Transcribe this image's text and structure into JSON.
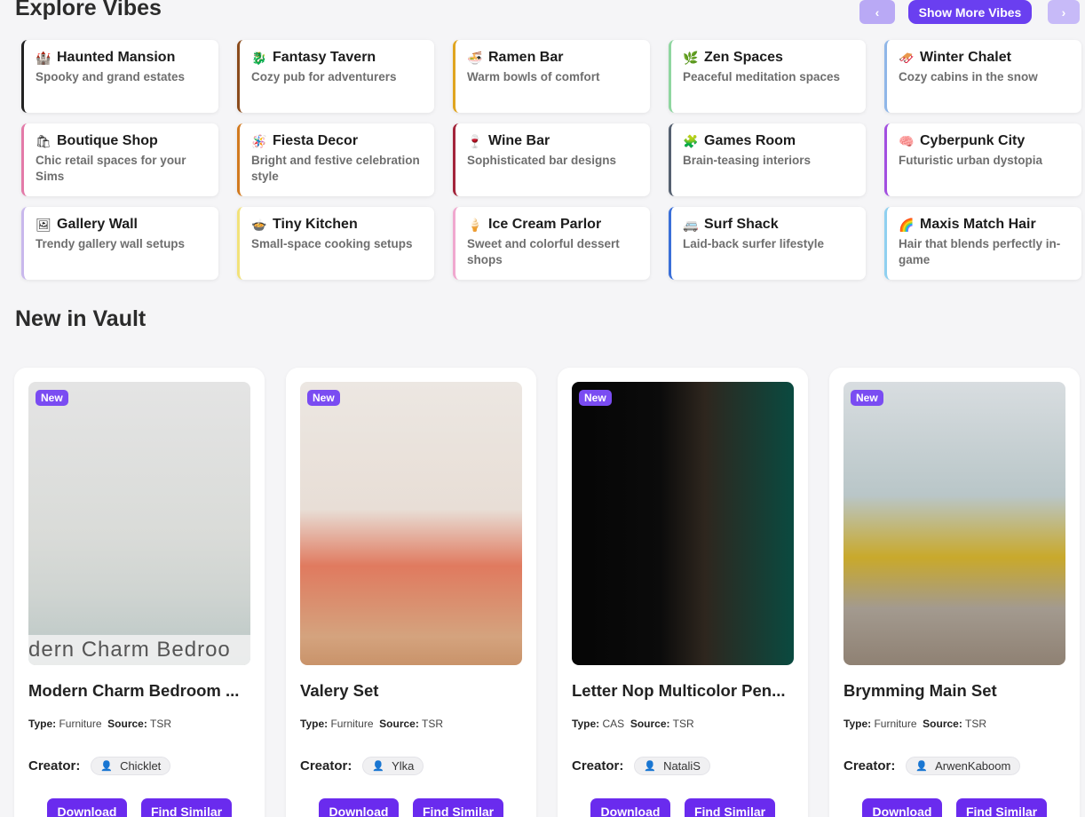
{
  "explore": {
    "title": "Explore Vibes",
    "prev_label": "‹",
    "more_label": "Show More Vibes",
    "next_label": "›",
    "vibes": [
      {
        "icon": "🏰",
        "name": "Haunted Mansion",
        "desc": "Spooky and grand estates",
        "color": "#222222"
      },
      {
        "icon": "🐉",
        "name": "Fantasy Tavern",
        "desc": "Cozy pub for adventurers",
        "color": "#8a4b1c"
      },
      {
        "icon": "🍜",
        "name": "Ramen Bar",
        "desc": "Warm bowls of comfort",
        "color": "#e0a520"
      },
      {
        "icon": "🌿",
        "name": "Zen Spaces",
        "desc": "Peaceful meditation spaces",
        "color": "#8fd6a0"
      },
      {
        "icon": "🛷",
        "name": "Winter Chalet",
        "desc": "Cozy cabins in the snow",
        "color": "#8fb6e8"
      },
      {
        "icon": "🛍",
        "name": "Boutique Shop",
        "desc": "Chic retail spaces for your Sims",
        "color": "#e37aa8"
      },
      {
        "icon": "🪅",
        "name": "Fiesta Decor",
        "desc": "Bright and festive celebration style",
        "color": "#d27a1f"
      },
      {
        "icon": "🍷",
        "name": "Wine Bar",
        "desc": "Sophisticated bar designs",
        "color": "#a3243a"
      },
      {
        "icon": "🧩",
        "name": "Games Room",
        "desc": "Brain-teasing interiors",
        "color": "#556070"
      },
      {
        "icon": "🧠",
        "name": "Cyberpunk City",
        "desc": "Futuristic urban dystopia",
        "color": "#a24fe0"
      },
      {
        "icon": "🖼",
        "name": "Gallery Wall",
        "desc": "Trendy gallery wall setups",
        "color": "#c9b8ec"
      },
      {
        "icon": "🍲",
        "name": "Tiny Kitchen",
        "desc": "Small-space cooking setups",
        "color": "#f2e27a"
      },
      {
        "icon": "🍦",
        "name": "Ice Cream Parlor",
        "desc": "Sweet and colorful dessert shops",
        "color": "#f0a8cf"
      },
      {
        "icon": "🚐",
        "name": "Surf Shack",
        "desc": "Laid-back surfer lifestyle",
        "color": "#3a6fd8"
      },
      {
        "icon": "🌈",
        "name": "Maxis Match Hair",
        "desc": "Hair that blends perfectly in-game",
        "color": "#8fd0f0"
      }
    ]
  },
  "vault": {
    "title": "New in Vault",
    "type_label": "Type:",
    "source_label": "Source:",
    "creator_label": "Creator:",
    "download_label": "Download",
    "similar_label": "Find Similar",
    "badge": "New",
    "items": [
      {
        "title": "Modern Charm Bedroom ...",
        "type": "Furniture",
        "source": "TSR",
        "creator": "Chicklet",
        "thumb_text": "dern Charm Bedroo"
      },
      {
        "title": "Valery Set",
        "type": "Furniture",
        "source": "TSR",
        "creator": "Ylka",
        "thumb_text": ""
      },
      {
        "title": "Letter Nop Multicolor Pen...",
        "type": "CAS",
        "source": "TSR",
        "creator": "NataliS",
        "thumb_text": ""
      },
      {
        "title": "Brymming Main Set",
        "type": "Furniture",
        "source": "TSR",
        "creator": "ArwenKaboom",
        "thumb_text": ""
      }
    ]
  }
}
